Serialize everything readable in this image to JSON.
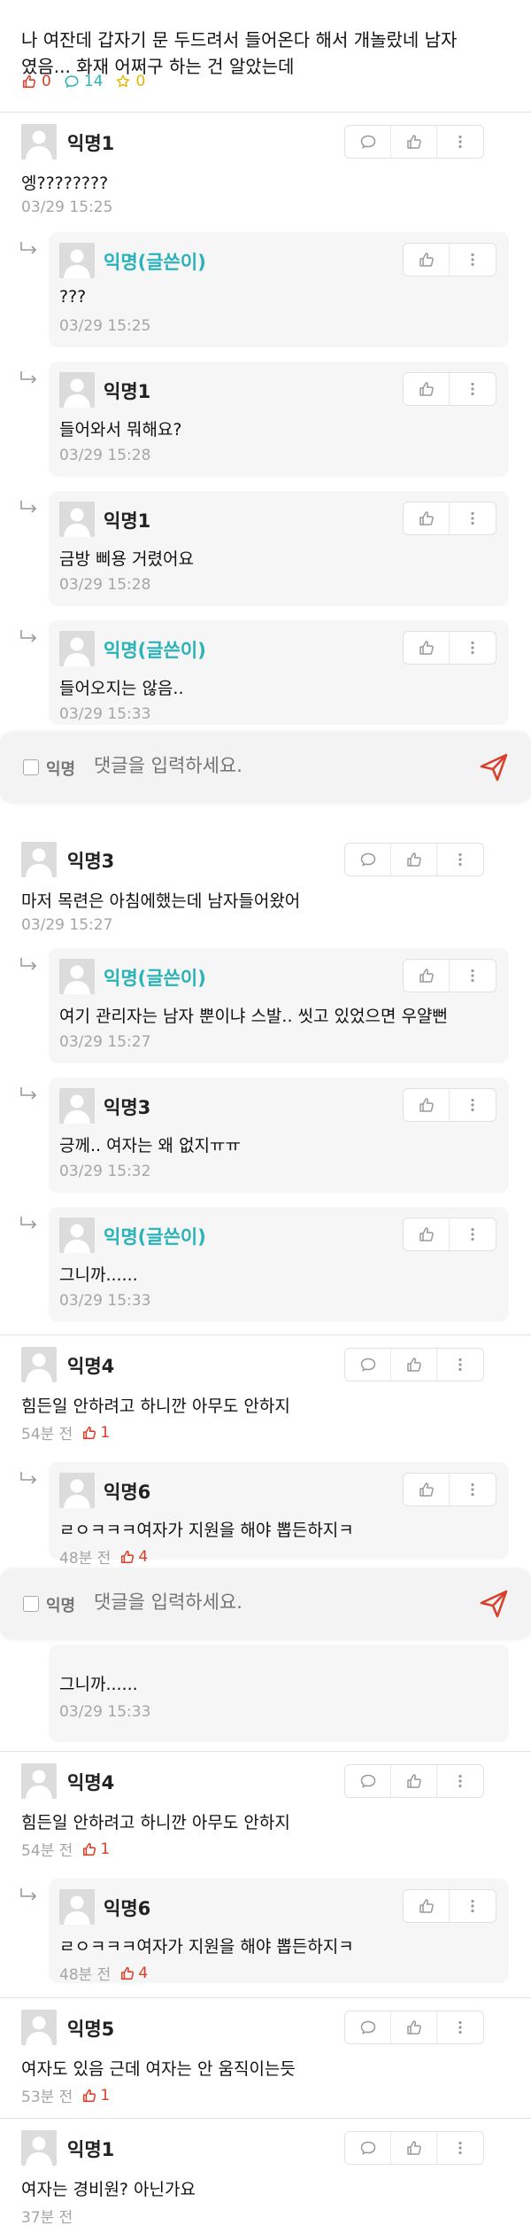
{
  "post": {
    "text_line1": "나 여잔데 갑자기 문 두드려서 들어온다 해서 개놀랐네 남자",
    "text_line2": "였음... 화재 어쩌구 하는 건 알았는데",
    "likes": "0",
    "comments": "14",
    "scraps": "0"
  },
  "input": {
    "anon_label": "익명",
    "placeholder": "댓글을 입력하세요."
  },
  "threads": [
    {
      "name": "익명1",
      "text": "엥????????",
      "time": "03/29 15:25",
      "replies": [
        {
          "name": "익명(글쓴이)",
          "text": "???",
          "time": "03/29 15:25"
        },
        {
          "name": "익명1",
          "text": "들어와서 뭐해요?",
          "time": "03/29 15:28"
        },
        {
          "name": "익명1",
          "text": "금방 삐용 거렸어요",
          "time": "03/29 15:28"
        },
        {
          "name": "익명(글쓴이)",
          "text": "들어오지는 않음..",
          "time": "03/29 15:33"
        }
      ]
    },
    {
      "name": "익명3",
      "text": "마저 목련은 아침에했는데 남자들어왔어",
      "time": "03/29 15:27",
      "replies": [
        {
          "name": "익명(글쓴이)",
          "text": "여기 관리자는 남자 뿐이냐 스발.. 씻고 있었으면 우얄뻔",
          "time": "03/29 15:27"
        },
        {
          "name": "익명3",
          "text": "긍께.. 여자는 왜 없지ㅠㅠ",
          "time": "03/29 15:32"
        },
        {
          "name": "익명(글쓴이)",
          "text": "그니까......",
          "time": "03/29 15:33"
        }
      ]
    },
    {
      "name": "익명4",
      "text": "힘든일 안하려고 하니깐 아무도 안하지",
      "time": "54분 전",
      "votes": "1",
      "replies": [
        {
          "name": "익명6",
          "text": "ㄹㅇㅋㅋㅋ여자가 지원을 해야 뽑든하지ㅋ",
          "time": "48분 전",
          "votes": "4"
        }
      ]
    },
    {
      "partial_reply": {
        "text": "그니까......",
        "time": "03/29 15:33"
      }
    },
    {
      "name": "익명4",
      "text": "힘든일 안하려고 하니깐 아무도 안하지",
      "time": "54분 전",
      "votes": "1",
      "replies": [
        {
          "name": "익명6",
          "text": "ㄹㅇㅋㅋㅋ여자가 지원을 해야 뽑든하지ㅋ",
          "time": "48분 전",
          "votes": "4"
        }
      ]
    },
    {
      "name": "익명5",
      "text": "여자도 있음 근데 여자는 안 움직이는듯",
      "time": "53분 전",
      "votes": "1"
    },
    {
      "name": "익명1",
      "text": "여자는 경비원? 아닌가요",
      "time": "37분 전"
    }
  ],
  "colors": {
    "writer": "#2ab3b8",
    "like": "#d8402b",
    "comment": "#2ab3b8",
    "scrap": "#e8b400",
    "send": "#d8402b"
  },
  "icons": {
    "reply_button": "speech-bubble-icon",
    "like_button": "thumbs-up-icon",
    "more_button": "more-vertical-icon",
    "send_button": "send-icon"
  }
}
